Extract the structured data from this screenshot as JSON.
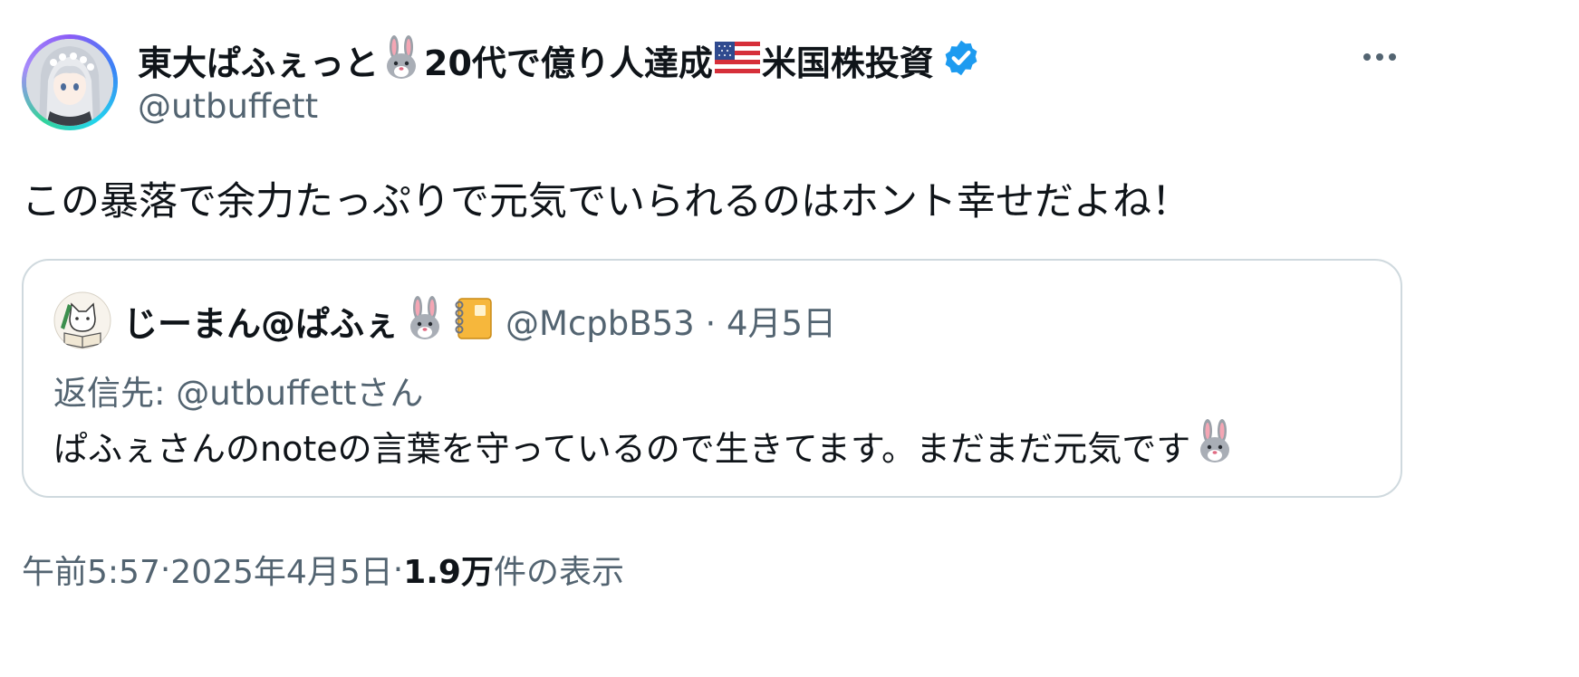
{
  "author": {
    "name_part1": "東大ぱふぇっと",
    "name_part2": "20代で億り人達成",
    "name_part3": "米国株投資",
    "handle": "@utbuffett",
    "verified_color": "#1d9bf0"
  },
  "tweet": {
    "text": "この暴落で余力たっぷりで元気でいられるのはホント幸せだよね！"
  },
  "quote": {
    "name": "じーまん@ぱふぇ",
    "handle": "@McpbB53",
    "separator": " · ",
    "date": "4月5日",
    "reply_prefix": "返信先: ",
    "reply_to": "@utbuffettさん",
    "text": "ぱふぇさんのnoteの言葉を守っているので生きてます。まだまだ元気です"
  },
  "footer": {
    "time": "午前5:57",
    "sep1": " · ",
    "date": "2025年4月5日",
    "sep2": " · ",
    "views_count": "1.9万",
    "views_label": " 件の表示"
  },
  "icons": {
    "verified": "verified-badge-icon",
    "more": "more-horizontal-icon",
    "rabbit": "rabbit-face-emoji",
    "us_flag": "us-flag-emoji",
    "notebook": "notebook-emoji"
  }
}
